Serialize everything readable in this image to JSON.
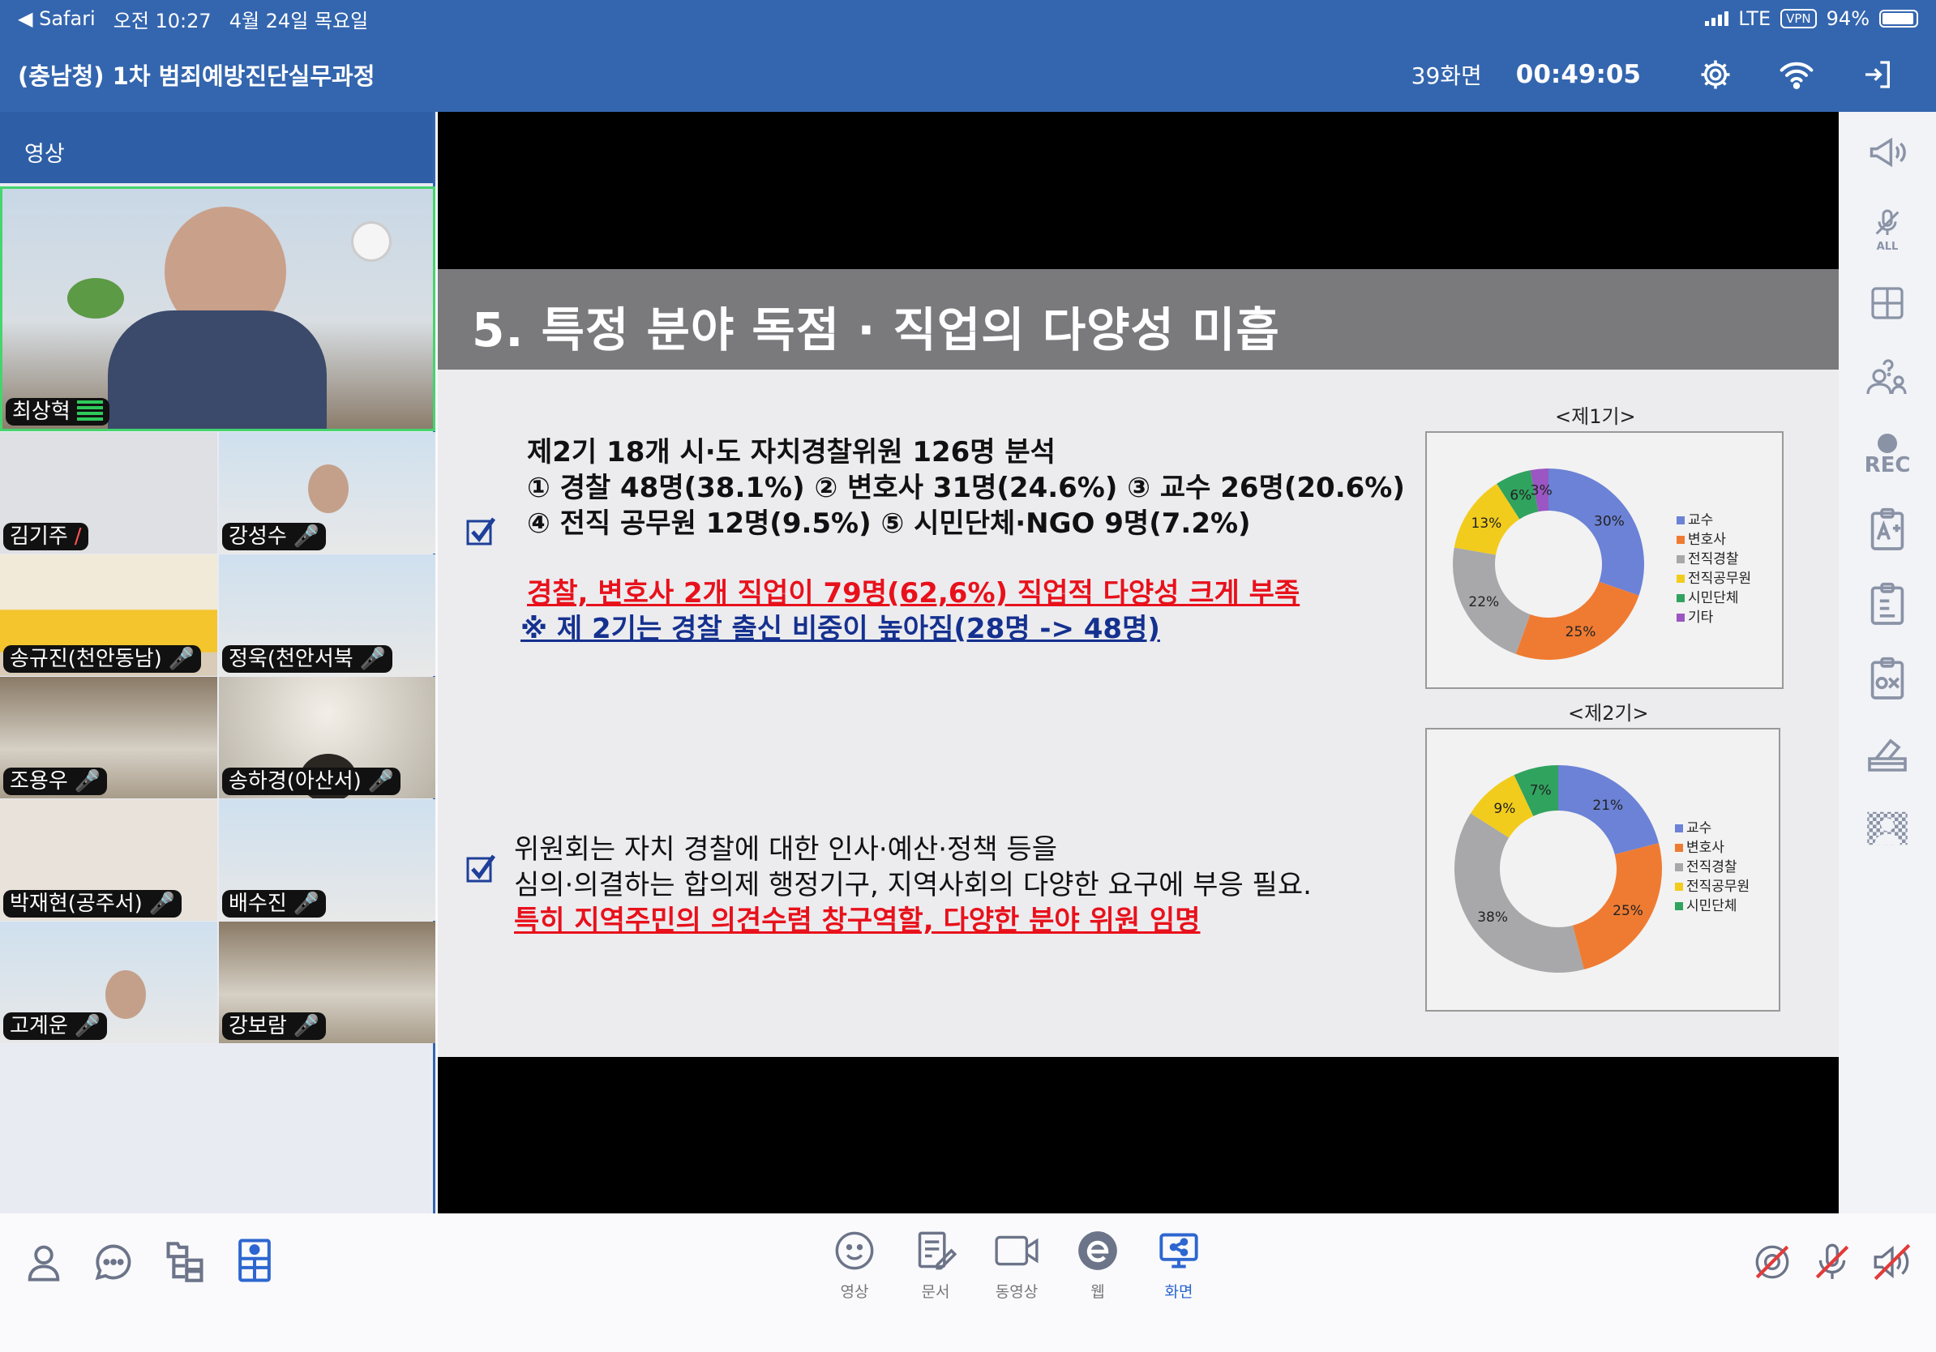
{
  "status": {
    "app": "Safari",
    "time": "오전 10:27",
    "date": "4월 24일 목요일",
    "network": "LTE",
    "vpn": "VPN",
    "battery": "94%",
    "battery_level": 0.94
  },
  "header": {
    "title": "(충남청) 1차 범죄예방진단실무과정",
    "screen_count": "39화면",
    "timer": "00:49:05"
  },
  "panel": {
    "title": "영상"
  },
  "participants": [
    {
      "name": "최상혁"
    },
    {
      "name": "김기주"
    },
    {
      "name": "강성수"
    },
    {
      "name": "송규진(천안동남)"
    },
    {
      "name": "정욱(천안서북"
    },
    {
      "name": "조용우"
    },
    {
      "name": "송하경(아산서)"
    },
    {
      "name": "박재현(공주서)"
    },
    {
      "name": "배수진"
    },
    {
      "name": "고계운"
    },
    {
      "name": "강보람"
    }
  ],
  "slide": {
    "title": "5. 특정 분야 독점 · 직업의 다양성 미흡",
    "block1": {
      "line1": "제2기 18개 시·도 자치경찰위원 126명 분석",
      "line2": "① 경찰 48명(38.1%) ② 변호사 31명(24.6%) ③ 교수 26명(20.6%)",
      "line3": "④ 전직 공무원 12명(9.5%) ⑤ 시민단체·NGO 9명(7.2%)",
      "red": "경찰, 변호사 2개 직업이 79명(62,6%) 직업적 다양성 크게 부족",
      "blue": "※ 제 2기는 경찰 출신 비중이 높아짐(28명 -> 48명)"
    },
    "block2": {
      "line1": "위원회는 자치 경찰에 대한 인사·예산·정책 등을",
      "line2": "심의·의결하는 합의제 행정기구, 지역사회의 다양한 요구에 부응 필요.",
      "red": "특히 지역주민의 의견수렴 창구역할, 다양한 분야 위원 임명"
    }
  },
  "chart_data": [
    {
      "type": "pie",
      "title": "<제1기>",
      "categories": [
        "교수",
        "변호사",
        "전직경찰",
        "전직공무원",
        "시민단체",
        "기타"
      ],
      "values": [
        30,
        25,
        22,
        13,
        6,
        3
      ],
      "labels": [
        "30%",
        "25%",
        "22%",
        "13%",
        "6%",
        "3%"
      ],
      "colors": [
        "#6b82d6",
        "#ef7b32",
        "#a8a8aa",
        "#f2cc1c",
        "#30a35f",
        "#9a56c2"
      ],
      "legend": "right"
    },
    {
      "type": "pie",
      "title": "<제2기>",
      "categories": [
        "교수",
        "변호사",
        "전직경찰",
        "전직공무원",
        "시민단체"
      ],
      "values": [
        21,
        25,
        38,
        9,
        7
      ],
      "labels": [
        "21%",
        "25%",
        "38%",
        "9%",
        "7%"
      ],
      "colors": [
        "#6b82d6",
        "#ef7b32",
        "#a8a8aa",
        "#f2cc1c",
        "#30a35f"
      ],
      "legend": "right"
    }
  ],
  "rail": {
    "rec": "REC",
    "all": "ALL",
    "ox": "OX"
  },
  "toolbar": {
    "video": "영상",
    "document": "문서",
    "movie": "동영상",
    "web": "웹",
    "screen": "화면"
  }
}
